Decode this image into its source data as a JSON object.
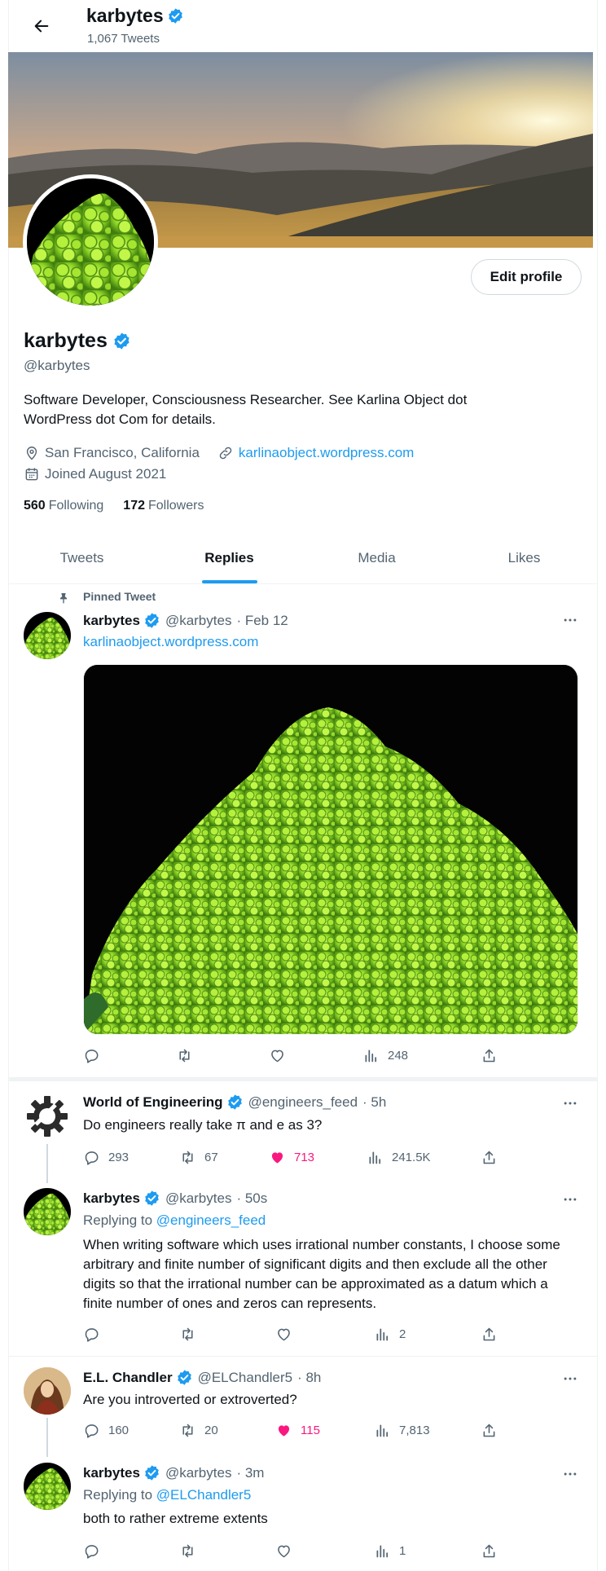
{
  "header": {
    "name": "karbytes",
    "tweet_count": "1,067 Tweets"
  },
  "profile": {
    "name": "karbytes",
    "handle": "@karbytes",
    "bio": "Software Developer, Consciousness Researcher. See Karlina Object dot WordPress dot Com for details.",
    "location": "San Francisco, California",
    "website": "karlinaobject.wordpress.com",
    "joined": "Joined August 2021",
    "following_count": "560",
    "following_label": "Following",
    "followers_count": "172",
    "followers_label": "Followers",
    "edit_button": "Edit profile"
  },
  "tabs": [
    "Tweets",
    "Replies",
    "Media",
    "Likes"
  ],
  "active_tab": "Replies",
  "colors": {
    "accent": "#1d9bf0",
    "like": "#f91880",
    "secondary_text": "#536471"
  },
  "tweets": [
    {
      "pinned_label": "Pinned Tweet",
      "name": "karbytes",
      "handle": "@karbytes",
      "time": "· Feb 12",
      "link": "karlinaobject.wordpress.com",
      "views": "248"
    },
    {
      "name": "World of Engineering",
      "handle": "@engineers_feed",
      "time": "· 5h",
      "text": "Do engineers really take π and e as 3?",
      "replies": "293",
      "retweets": "67",
      "likes": "713",
      "views": "241.5K"
    },
    {
      "name": "karbytes",
      "handle": "@karbytes",
      "time": "· 50s",
      "replying_prefix": "Replying to",
      "replying_to": "@engineers_feed",
      "text": "When writing software which uses irrational number constants, I choose some arbitrary and finite number of significant digits and then exclude all the other digits so that the irrational number can be approximated as a datum which a finite number of ones and zeros can represents.",
      "views": "2"
    },
    {
      "name": "E.L. Chandler",
      "handle": "@ELChandler5",
      "time": "· 8h",
      "text": "Are you introverted or extroverted?",
      "replies": "160",
      "retweets": "20",
      "likes": "115",
      "views": "7,813"
    },
    {
      "name": "karbytes",
      "handle": "@karbytes",
      "time": "· 3m",
      "replying_prefix": "Replying to",
      "replying_to": "@ELChandler5",
      "text": "both to rather extreme extents",
      "views": "1"
    }
  ]
}
